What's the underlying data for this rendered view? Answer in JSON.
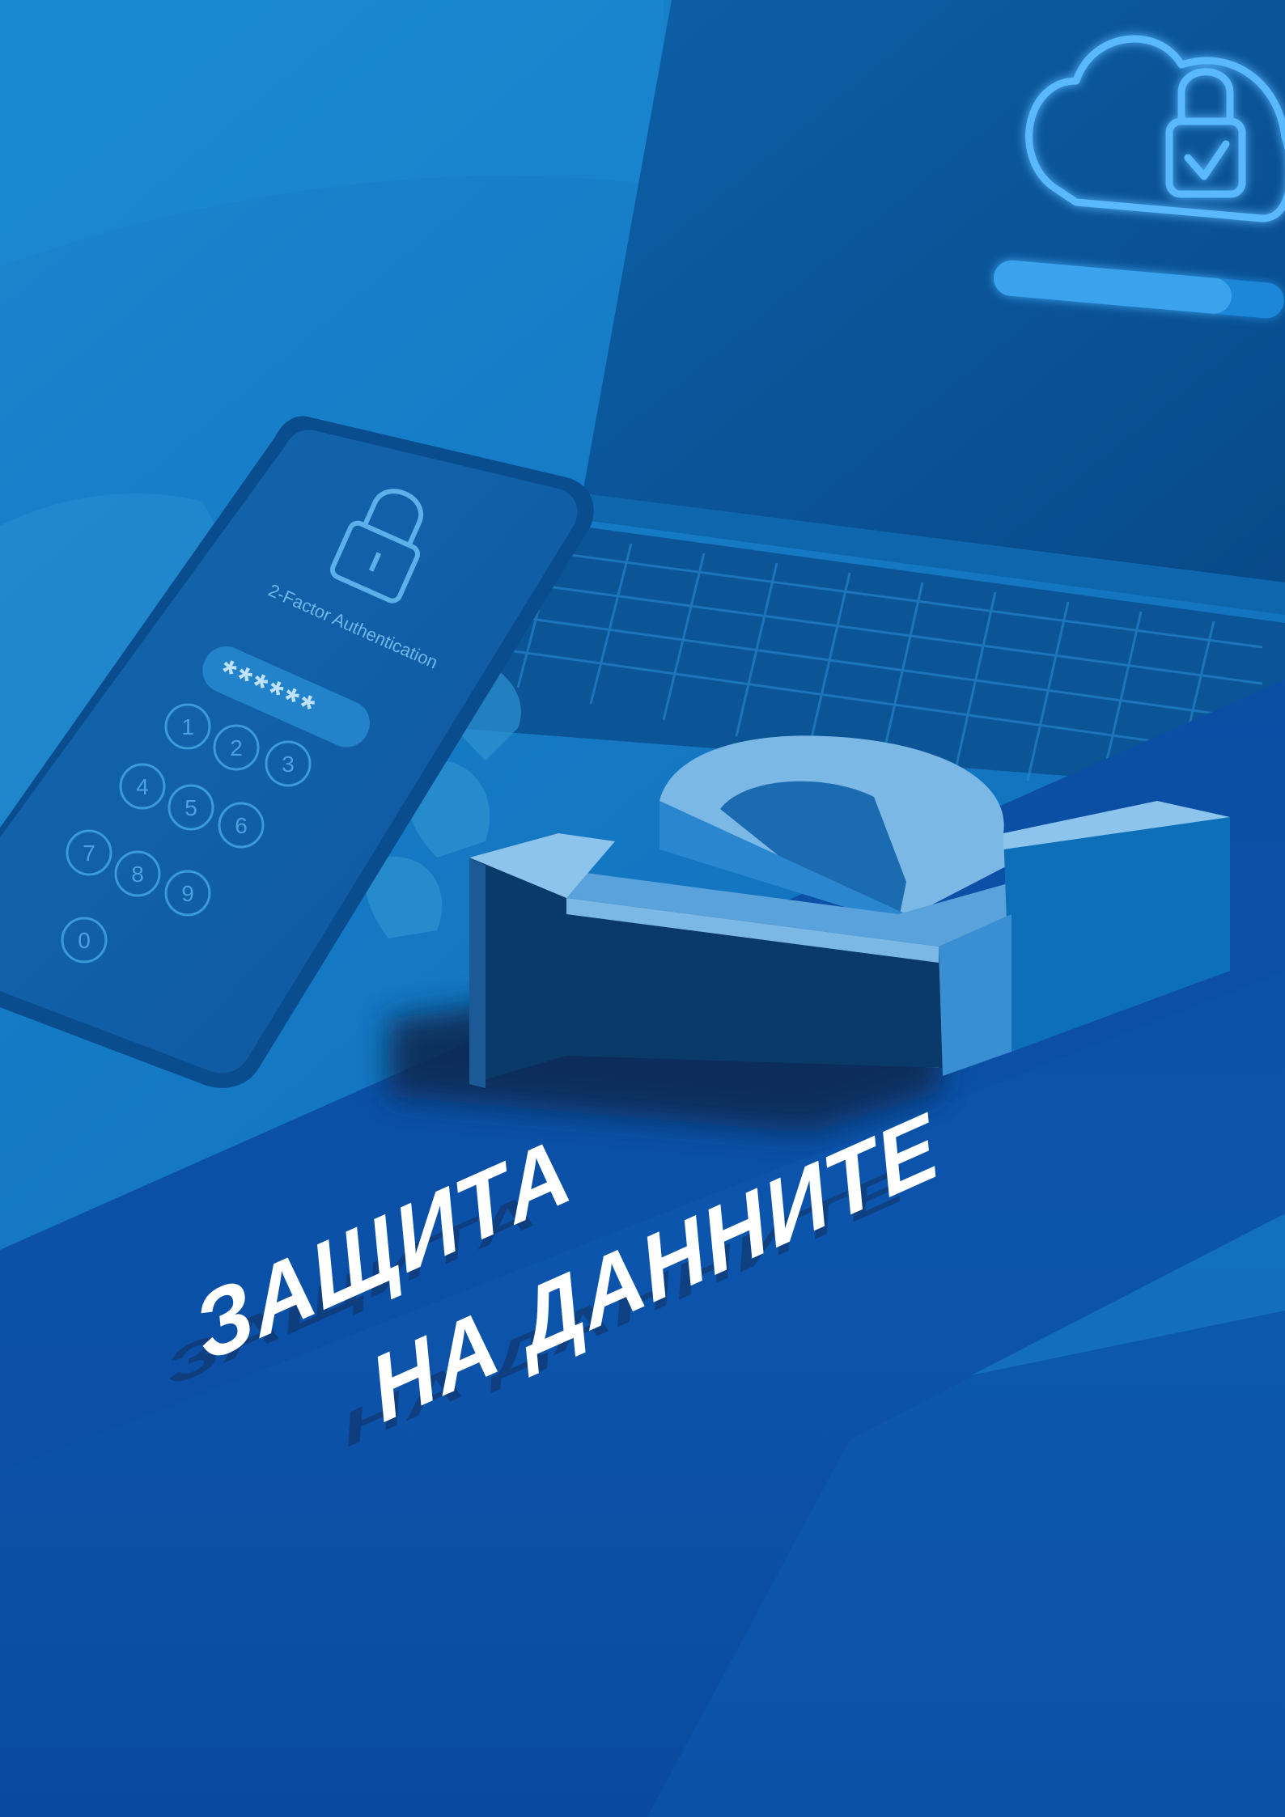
{
  "title": {
    "line1": "ЗАЩИТА",
    "line2": "НА ДАННИТЕ"
  },
  "phone": {
    "label": "2-Factor Authentication",
    "password_mask": "******",
    "keypad": [
      "1",
      "2",
      "3",
      "4",
      "5",
      "6",
      "7",
      "8",
      "9",
      "0"
    ],
    "lock_icon": "padlock-icon"
  },
  "laptop": {
    "screen_icon": "cloud-lock-check-icon",
    "progress_fraction": 0.82
  },
  "badge": {
    "icon": "2fa-number-2-icon"
  },
  "colors": {
    "primary_blue": "#0a4aa0",
    "photo_tint": "#1479c6",
    "accent_light": "#6fb2e6",
    "glow": "#4fb4ff"
  }
}
